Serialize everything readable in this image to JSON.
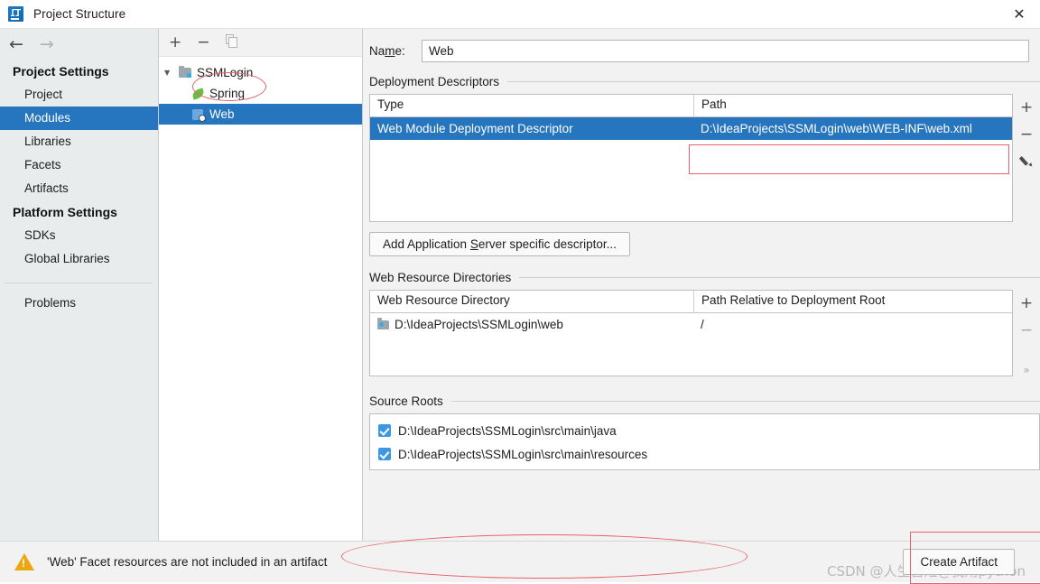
{
  "window": {
    "title": "Project Structure",
    "close_label": "✕",
    "app_icon": "intellij-idea-logo"
  },
  "sidebar": {
    "nav": {
      "back": "←",
      "forward": "→"
    },
    "groups": [
      {
        "label": "Project Settings",
        "items": [
          {
            "label": "Project",
            "selected": false
          },
          {
            "label": "Modules",
            "selected": true
          },
          {
            "label": "Libraries",
            "selected": false
          },
          {
            "label": "Facets",
            "selected": false
          },
          {
            "label": "Artifacts",
            "selected": false
          }
        ]
      },
      {
        "label": "Platform Settings",
        "items": [
          {
            "label": "SDKs",
            "selected": false
          },
          {
            "label": "Global Libraries",
            "selected": false
          }
        ]
      }
    ],
    "problems_label": "Problems"
  },
  "tree": {
    "toolbar": {
      "add": "+",
      "remove": "−",
      "copy": "copy-icon"
    },
    "nodes": [
      {
        "label": "SSMLogin",
        "icon": "module-folder-icon",
        "level": 0,
        "expanded": true,
        "selected": false
      },
      {
        "label": "Spring",
        "icon": "spring-leaf-icon",
        "level": 1,
        "selected": false
      },
      {
        "label": "Web",
        "icon": "web-facet-icon",
        "level": 1,
        "selected": true
      }
    ]
  },
  "main": {
    "name_label_pre": "Na",
    "name_label_mnemonic": "m",
    "name_label_post": "e:",
    "name_value": "Web",
    "deployment": {
      "section_label": "Deployment Descriptors",
      "columns": [
        "Type",
        "Path"
      ],
      "rows": [
        {
          "type": "Web Module Deployment Descriptor",
          "path": "D:\\IdeaProjects\\SSMLogin\\web\\WEB-INF\\web.xml",
          "selected": true
        }
      ],
      "buttons": {
        "add": "+",
        "remove": "−",
        "edit": "pencil-icon"
      }
    },
    "add_descriptor_button": {
      "pre": "Add Application ",
      "mnemonic": "S",
      "post": "erver specific descriptor..."
    },
    "web_resources": {
      "section_label": "Web Resource Directories",
      "columns": [
        "Web Resource Directory",
        "Path Relative to Deployment Root"
      ],
      "rows": [
        {
          "directory": "D:\\IdeaProjects\\SSMLogin\\web",
          "relative_path": "/"
        }
      ],
      "buttons": {
        "add": "+",
        "remove": "−",
        "more": "»"
      }
    },
    "source_roots": {
      "section_label": "Source Roots",
      "rows": [
        {
          "path": "D:\\IdeaProjects\\SSMLogin\\src\\main\\java",
          "checked": true
        },
        {
          "path": "D:\\IdeaProjects\\SSMLogin\\src\\main\\resources",
          "checked": true
        }
      ]
    }
  },
  "bottom": {
    "warning_icon": "warning-triangle-icon",
    "warning_text": "'Web' Facet resources are not included in an artifact",
    "create_artifact_label": "Create Artifact",
    "watermark": "CSDN @人生苦短@我用python"
  },
  "colors": {
    "selection_blue": "#2675bf",
    "annotation_red": "#e8606a",
    "warning_orange": "#eda512",
    "sidebar_bg": "#e8eced"
  }
}
